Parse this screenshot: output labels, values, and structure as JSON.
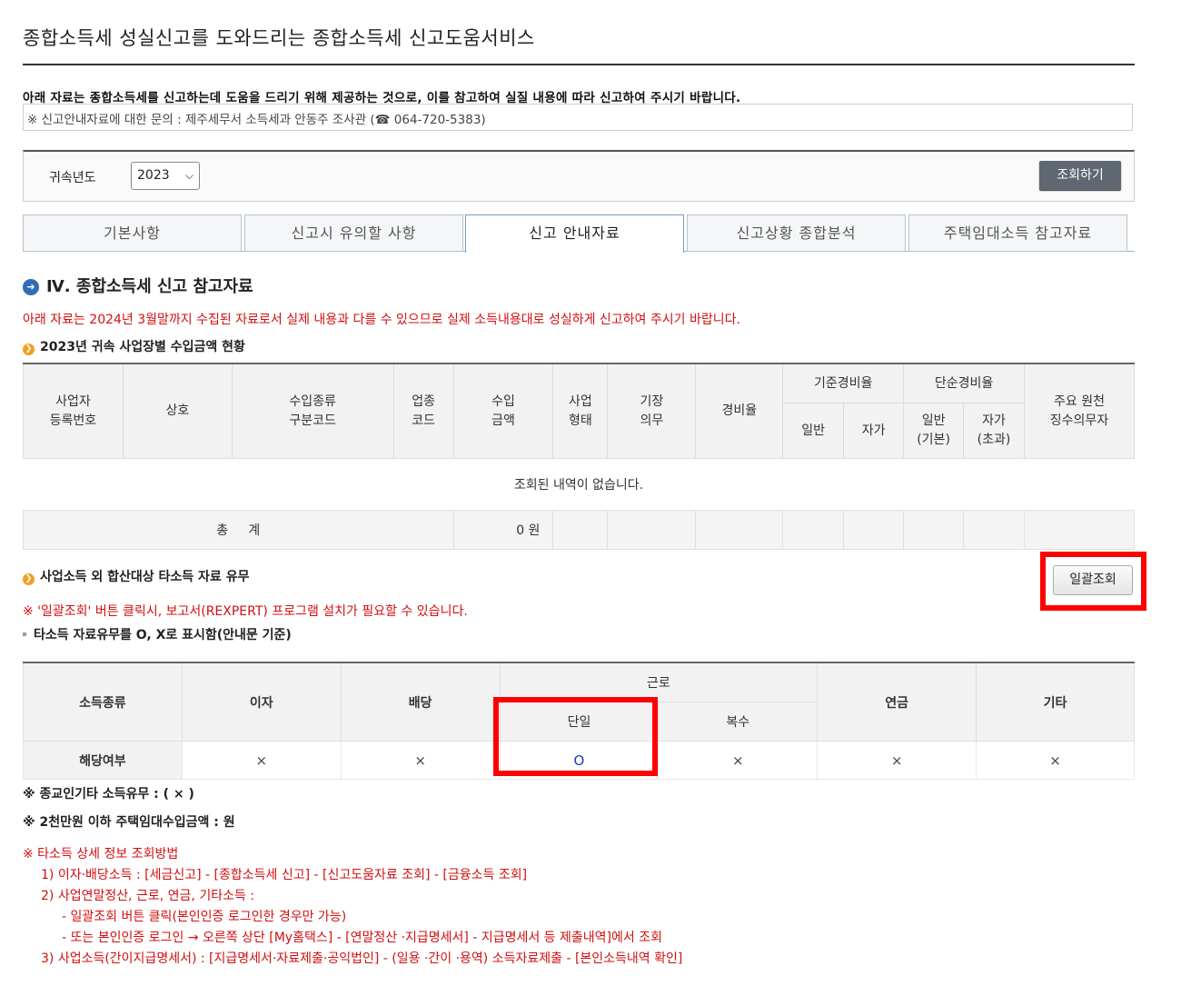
{
  "page_title": "종합소득세 성실신고를 도와드리는 종합소득세 신고도움서비스",
  "notice": "아래 자료는 종합소득세를 신고하는데 도움을 드리기 위해 제공하는 것으로, 이를 참고하여 실질 내용에 따라 신고하여 주시기 바랍니다.",
  "inquiry": "※ 신고안내자료에 대한 문의 : 제주세무서 소득세과 안동주 조사관 (☎ 064-720-5383)",
  "year_filter": {
    "label": "귀속년도",
    "selected": "2023",
    "search_button": "조회하기"
  },
  "tabs": [
    {
      "label": "기본사항",
      "active": false
    },
    {
      "label": "신고시 유의할 사항",
      "active": false
    },
    {
      "label": "신고 안내자료",
      "active": true
    },
    {
      "label": "신고상황 종합분석",
      "active": false
    },
    {
      "label": "주택임대소득 참고자료",
      "active": false
    }
  ],
  "section": {
    "title": "Ⅳ. 종합소득세 신고 참고자료",
    "disclaimer": "아래 자료는 2024년 3월말까지 수집된 자료로서 실제 내용과 다를 수 있으므로 실제 소득내용대로 성실하게 신고하여 주시기 바랍니다.",
    "business_heading": "2023년 귀속 사업장별 수입금액 현황",
    "business_table": {
      "headers": {
        "reg_no": [
          "사업자",
          "등록번호"
        ],
        "trade_name": "상호",
        "income_code": [
          "수입종류",
          "구분코드"
        ],
        "industry_code": [
          "업종",
          "코드"
        ],
        "income_amount": [
          "수입",
          "금액"
        ],
        "biz_type": [
          "사업",
          "형태"
        ],
        "bookkeeping": [
          "기장",
          "의무"
        ],
        "expense_rate": "경비율",
        "standard_rate": "기준경비율",
        "simple_rate": "단순경비율",
        "withholder": [
          "주요 원천",
          "징수의무자"
        ],
        "general": "일반",
        "own": "자가",
        "general_basic": [
          "일반",
          "(기본)"
        ],
        "own_excess": [
          "자가",
          "(초과)"
        ]
      },
      "empty_message": "조회된 내역이 없습니다.",
      "total_label": "총     계",
      "total_amount": "0 원"
    },
    "other_income_heading": "사업소득 외 합산대상 타소득 자료 유무",
    "bulk_button": "일괄조회",
    "bulk_note": "※ '일괄조회' 버튼 클릭시, 보고서(REXPERT) 프로그램 설치가 필요할 수 있습니다.",
    "ox_note": "타소득 자료유무를 O, X로 표시함(안내문 기준)",
    "other_income_table": {
      "row_header": "소득종류",
      "columns": [
        "이자",
        "배당",
        "근로",
        "연금",
        "기타"
      ],
      "labor_sub": [
        "단일",
        "복수"
      ],
      "data_row_label": "해당여부",
      "values": [
        "×",
        "×",
        "O",
        "×",
        "×",
        "×"
      ]
    },
    "religious_note": "※ 종교인기타 소득유무 : ( × )",
    "rental_note": "※ 2천만원 이하 주택임대수입금액 : 원",
    "howto": {
      "title": "※ 타소득 상세 정보 조회방법",
      "lines": [
        "1) 이자·배당소득 : [세금신고] - [종합소득세 신고] - [신고도움자료 조회] - [금융소득 조회]",
        "2) 사업연말정산, 근로, 연금, 기타소득 :",
        "- 일괄조회 버튼 클릭(본인인증 로그인한 경우만 가능)",
        "- 또는 본인인증 로그인 → 오른쪽 상단 [My홈택스] - [연말정산 ·지급명세서] - 지급명세서 등 제출내역]에서 조회",
        "3) 사업소득(간이지급명세서) : [지급명세서·자료제출·공익법인] - (일용 ·간이 ·용역) 소득자료제출 - [본인소득내역 확인]"
      ]
    }
  }
}
